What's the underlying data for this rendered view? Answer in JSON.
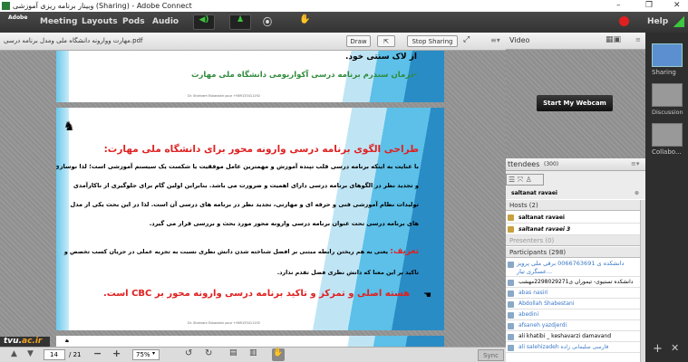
{
  "window": {
    "title": "وبینار برنامه ریزی آموزشی (Sharing) - Adobe Connect",
    "minimize": "–",
    "maximize": "❐",
    "close": "✕"
  },
  "menubar": {
    "logo": "Adobe",
    "items": [
      "Meeting",
      "Layouts",
      "Pods",
      "Audio"
    ],
    "help": "Help",
    "colors": {
      "speaker": "#3ec43e",
      "record": "#e02020",
      "signal": "#3cc83c"
    }
  },
  "share_pod": {
    "filename": "مهارت ووارونه دانشگاه ملی ومدل برنامه درسی.pdf",
    "draw_label": "Draw",
    "stop_sharing_label": "Stop Sharing",
    "slide_prev": {
      "line1": "از لاک سنتی خود.",
      "line2": "-درمان سندرم برنامه درسی آکواریومی دانشگاه ملی مهارت",
      "footer": "Dr. Shahram Eskandari pour +989133411192"
    },
    "slide": {
      "title": "طراحی الگوی برنامه درسی وارونه محور برای دانشگاه ملی مهارت:",
      "paragraph": [
        "با عنایت به اینکه برنامه درسی قلب تپنده آموزش و مهمترین عامل موفقیت یا شکست یک سیستم آموزشی است؛ لذا نوسازی",
        "و تجدید نظر در الگوهای برنامه درسی دارای اهمیت و ضرورت می باشد. بنابراین اولین گام برای جلوگیری از ناکارآمدی",
        "تولیدات نظام آموزشی فنی و حرفه ای و مهارتی، تجدید نظر در برنامه های درسی آن است. لذا در این بحث یکی از مدل",
        "های برنامه درسی تحت عنوان برنامه درسی وارونه محور مورد بحث و بررسی قرار می گیرد."
      ],
      "definition_label": "تعریف:",
      "definition": "یعنی به هم ریختن رابطه مبتنی بر افضل شناخته شدن دانش نظری نسبت به تجربه عملی در جریان کسب تخصص و",
      "definition2": "تاکید بر این معنا که دانش نظری فضل تقدم ندارد.",
      "core": "هسته اصلی و تمرکز و تاکید برنامه درسی وارونه محور بر CBC است.",
      "footer": "Dr. Shahram Eskandari pour +989133411192"
    },
    "toolbar": {
      "page": "14",
      "total": "/ 21",
      "zoom": "75%",
      "sync": "Sync"
    },
    "watermark": "tvu.ac.ir"
  },
  "video_pod": {
    "title": "Video",
    "webcam_button": "Start My Webcam"
  },
  "attendees": {
    "title": "ttendees",
    "count": "(300)",
    "search": "saltanat ravaei",
    "hosts_label": "Hosts (2)",
    "hosts": [
      "saltanat ravaei",
      "saltanat ravaei 3"
    ],
    "presenters_label": "Presenters (0)",
    "participants_label": "Participants (298)",
    "participants": [
      "دانشکده ی 0066763691 برقی ملی پرویز عسگری تیار...",
      "دانشکده تستیوی- تیموران ی2298029271مهشب",
      "abas nasiri",
      "Abdollah Shabestani",
      "abedini",
      "afsaneh yazdjerdi",
      "ali khatibi _ keshavarzi damavand",
      "ali salehizadeh فارسی سلیمانی زاده",
      ""
    ]
  },
  "layouts": {
    "items": [
      "Sharing",
      "Discussion",
      "Collabo..."
    ]
  }
}
